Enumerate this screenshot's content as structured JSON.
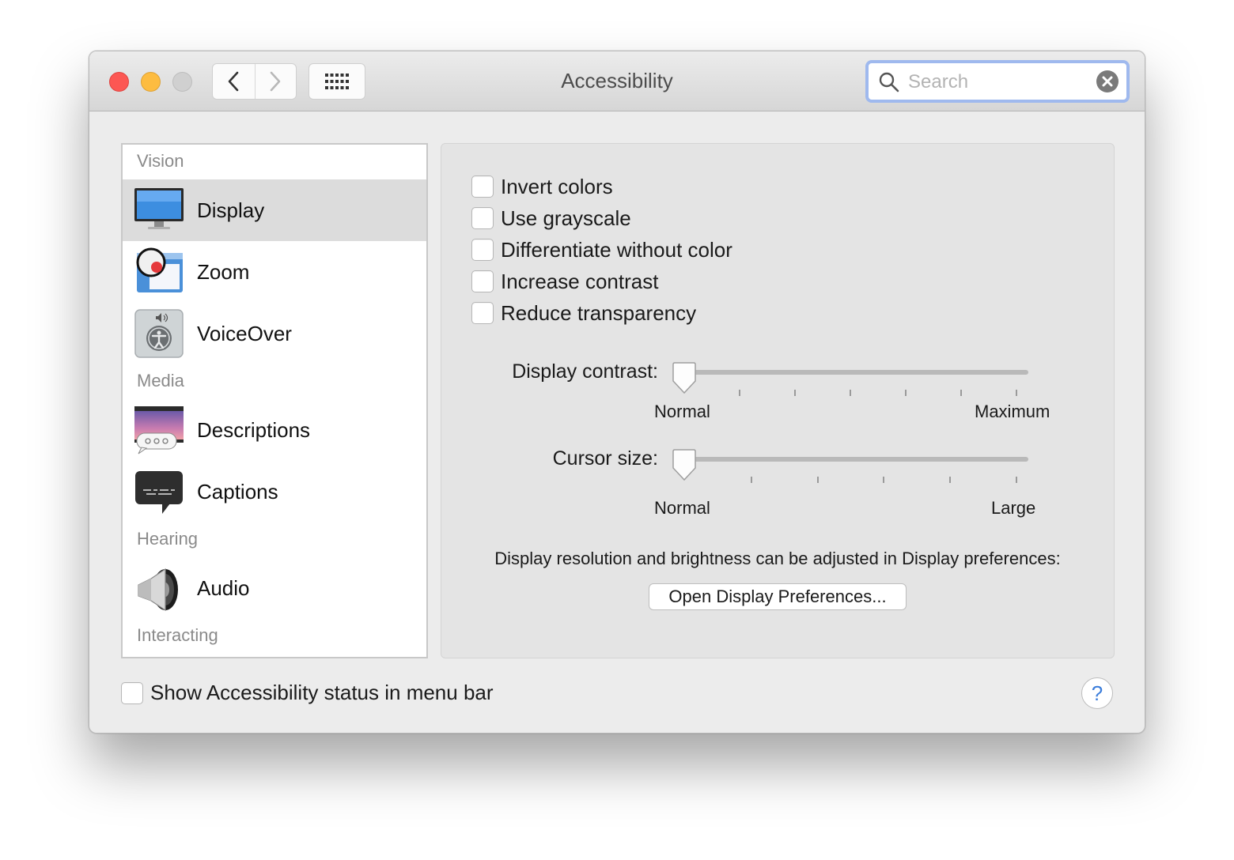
{
  "window": {
    "title": "Accessibility"
  },
  "search": {
    "placeholder": "Search"
  },
  "sidebar": {
    "sections": {
      "vision": "Vision",
      "media": "Media",
      "hearing": "Hearing",
      "interacting": "Interacting"
    },
    "items": [
      {
        "label": "Display",
        "icon": "display-icon",
        "selected": true
      },
      {
        "label": "Zoom",
        "icon": "zoom-icon"
      },
      {
        "label": "VoiceOver",
        "icon": "voiceover-icon"
      },
      {
        "label": "Descriptions",
        "icon": "descriptions-icon"
      },
      {
        "label": "Captions",
        "icon": "captions-icon"
      },
      {
        "label": "Audio",
        "icon": "audio-icon"
      }
    ]
  },
  "display": {
    "checkboxes": [
      {
        "label": "Invert colors",
        "checked": false
      },
      {
        "label": "Use grayscale",
        "checked": false
      },
      {
        "label": "Differentiate without color",
        "checked": false
      },
      {
        "label": "Increase contrast",
        "checked": false
      },
      {
        "label": "Reduce transparency",
        "checked": false
      }
    ],
    "contrast": {
      "label": "Display contrast:",
      "min_label": "Normal",
      "max_label": "Maximum",
      "value": 0
    },
    "cursor": {
      "label": "Cursor size:",
      "min_label": "Normal",
      "max_label": "Large",
      "value": 0
    },
    "note": "Display resolution and brightness can be adjusted in Display preferences:",
    "open_button": "Open Display Preferences..."
  },
  "footer": {
    "status_checkbox": "Show Accessibility status in menu bar",
    "status_checked": false,
    "help": "?"
  },
  "colors": {
    "close": "#fc5753",
    "minimize": "#fdbc40",
    "search_ring": "#9fb9ee",
    "help": "#3b7ddb"
  }
}
